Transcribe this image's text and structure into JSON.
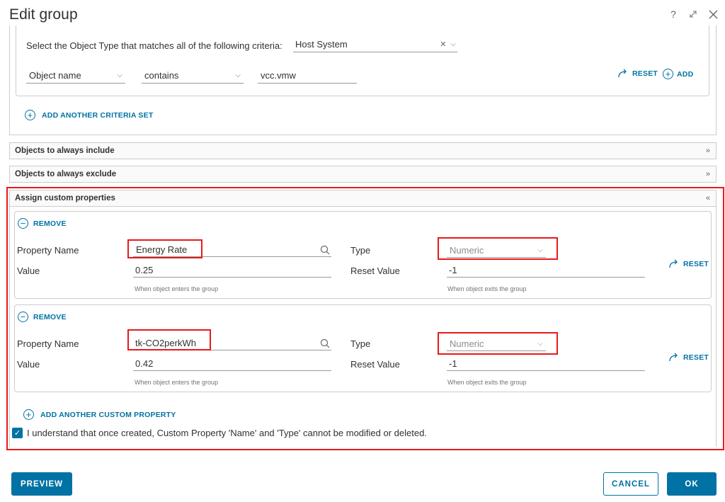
{
  "dialog": {
    "title": "Edit group"
  },
  "criteria": {
    "select_label": "Select the Object Type that matches all of the following criteria:",
    "object_type": "Host System",
    "field": "Object name",
    "operator": "contains",
    "value": "vcc.vmw",
    "reset_label": "RESET",
    "add_label": "ADD",
    "add_set_label": "ADD ANOTHER CRITERIA SET"
  },
  "sections": {
    "include": "Objects to always include",
    "exclude": "Objects to always exclude",
    "custom": "Assign custom properties"
  },
  "custom_properties": [
    {
      "remove_label": "REMOVE",
      "property_name_label": "Property Name",
      "property_name": "Energy Rate",
      "type_label": "Type",
      "type": "Numeric",
      "value_label": "Value",
      "value": "0.25",
      "reset_value_label": "Reset Value",
      "reset_value": "-1",
      "value_hint": "When object enters the group",
      "reset_hint": "When object exits the group",
      "reset_label": "RESET"
    },
    {
      "remove_label": "REMOVE",
      "property_name_label": "Property Name",
      "property_name": "tk-CO2perkWh",
      "type_label": "Type",
      "type": "Numeric",
      "value_label": "Value",
      "value": "0.42",
      "reset_value_label": "Reset Value",
      "reset_value": "-1",
      "value_hint": "When object enters the group",
      "reset_hint": "When object exits the group",
      "reset_label": "RESET"
    }
  ],
  "add_property_label": "ADD ANOTHER CUSTOM PROPERTY",
  "acknowledge": {
    "checked": true,
    "text": "I understand that once created, Custom Property 'Name' and 'Type' cannot be modified or deleted."
  },
  "footer": {
    "preview": "PREVIEW",
    "cancel": "CANCEL",
    "ok": "OK"
  },
  "colors": {
    "accent": "#0072a3",
    "highlight": "#e8191a"
  }
}
